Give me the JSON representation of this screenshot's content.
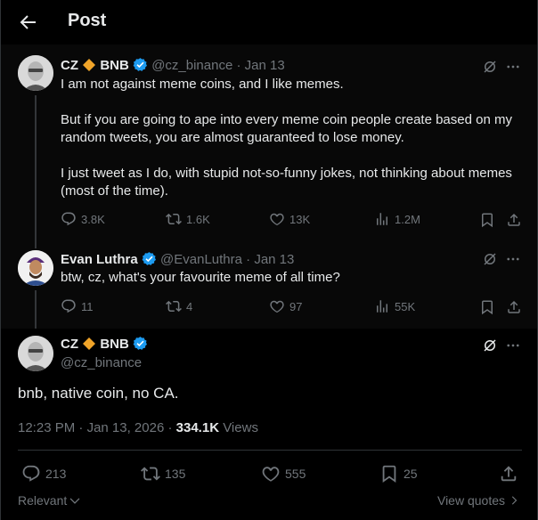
{
  "header": {
    "title": "Post"
  },
  "parent_post": {
    "name": "CZ",
    "name_suffix": "BNB",
    "handle": "@cz_binance",
    "date": "Jan 13",
    "paragraphs": [
      "I am not against meme coins, and I like memes.",
      "But if you are going to ape into every meme coin people create based on my random tweets, you are almost guaranteed to lose money.",
      "I just tweet as I do, with stupid not-so-funny jokes, not thinking about memes (most of the time)."
    ],
    "replies": "3.8K",
    "reposts": "1.6K",
    "likes": "13K",
    "views": "1.2M"
  },
  "reply_post": {
    "name": "Evan Luthra",
    "handle": "@EvanLuthra",
    "date": "Jan 13",
    "text": "btw, cz, what's your favourite meme of all time?",
    "replies": "11",
    "reposts": "4",
    "likes": "97",
    "views": "55K"
  },
  "main_post": {
    "name": "CZ",
    "name_suffix": "BNB",
    "handle": "@cz_binance",
    "text": "bnb, native coin, no CA.",
    "time": "12:23 PM",
    "date": "Jan 13, 2026",
    "views_count": "334.1K",
    "views_label": "Views",
    "replies": "213",
    "reposts": "135",
    "likes": "555",
    "bookmarks": "25"
  },
  "footer": {
    "sort_label": "Relevant",
    "quotes_label": "View quotes"
  },
  "colors": {
    "verified": "#1d9bf0",
    "diamond": "#f0a429",
    "muted": "#71767b",
    "text": "#e7e9ea"
  }
}
